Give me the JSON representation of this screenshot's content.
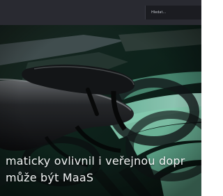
{
  "header": {
    "search_placeholder": "Hledat..."
  },
  "hero": {
    "headline_line_1": "maticky ovlivnil i veřejnou dopr",
    "headline_line_2": "může být MaaS"
  }
}
